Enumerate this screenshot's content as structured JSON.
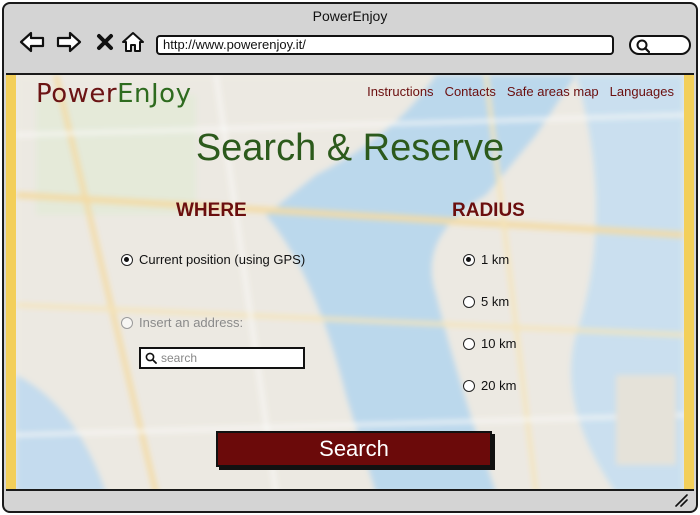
{
  "window": {
    "title": "PowerEnjoy"
  },
  "browser": {
    "url": "http://www.powerenjoy.it/",
    "icons": [
      "back-arrow-icon",
      "forward-arrow-icon",
      "stop-x-icon",
      "home-icon",
      "search-icon"
    ]
  },
  "site": {
    "logo_part1": "Power",
    "logo_part2": "EnJoy",
    "nav": [
      "Instructions",
      "Contacts",
      "Safe areas map",
      "Languages"
    ],
    "heading": "Search & Reserve"
  },
  "where": {
    "title": "WHERE",
    "options": [
      {
        "label": "Current position (using GPS)",
        "checked": true,
        "disabled": false
      },
      {
        "label": "Insert an address:",
        "checked": false,
        "disabled": true
      }
    ],
    "search_placeholder": "search"
  },
  "radius": {
    "title": "RADIUS",
    "options": [
      {
        "label": "1 km",
        "checked": true
      },
      {
        "label": "5 km",
        "checked": false
      },
      {
        "label": "10 km",
        "checked": false
      },
      {
        "label": "20 km",
        "checked": false
      }
    ]
  },
  "action": {
    "search_label": "Search"
  },
  "colors": {
    "brand_red": "#6b0e0e",
    "brand_green": "#2e6b1f",
    "button_bg": "#6b0a0a",
    "side_bar": "#f3cf5a"
  }
}
